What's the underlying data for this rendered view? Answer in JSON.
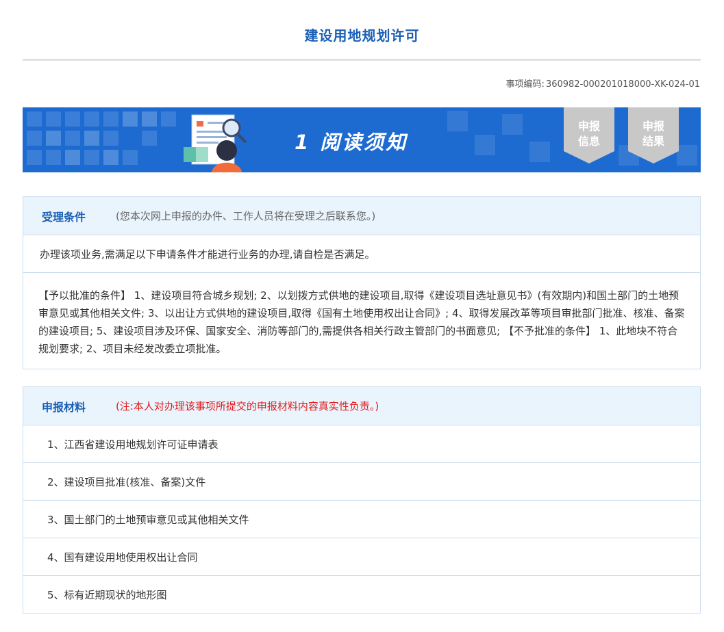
{
  "page": {
    "title": "建设用地规划许可",
    "item_code_label": "事项编码:",
    "item_code": "360982-000201018000-XK-024-01"
  },
  "banner": {
    "step_number": "1",
    "step_title": "阅读须知",
    "tabs": [
      {
        "label": "申报\n信息"
      },
      {
        "label": "申报\n结果"
      }
    ],
    "colors": {
      "background": "#1d6bd1",
      "tab": "#c8c8c8"
    }
  },
  "conditions": {
    "title": "受理条件",
    "note": "(您本次网上申报的办件、工作人员将在受理之后联系您。)",
    "intro": "办理该项业务,需满足以下申请条件才能进行业务的办理,请自检是否满足。",
    "body": "【予以批准的条件】 1、建设项目符合城乡规划; 2、以划拨方式供地的建设项目,取得《建设项目选址意见书》(有效期内)和国土部门的土地预审意见或其他相关文件; 3、以出让方式供地的建设项目,取得《国有土地使用权出让合同》; 4、取得发展改革等项目审批部门批准、核准、备案的建设项目; 5、建设项目涉及环保、国家安全、消防等部门的,需提供各相关行政主管部门的书面意见; 【不予批准的条件】 1、此地块不符合规划要求; 2、项目未经发改委立项批准。"
  },
  "materials": {
    "title": "申报材料",
    "note": "(注:本人对办理该事项所提交的申报材料内容真实性负责。)",
    "items": [
      "1、江西省建设用地规划许可证申请表",
      "2、建设项目批准(核准、备案)文件",
      "3、国土部门的土地预审意见或其他相关文件",
      "4、国有建设用地使用权出让合同",
      "5、标有近期现状的地形图"
    ]
  },
  "colors": {
    "accent": "#1a5fb4",
    "panel_header_bg": "#eaf4fd",
    "border": "#c9dcee",
    "warning": "#e01b1b"
  }
}
